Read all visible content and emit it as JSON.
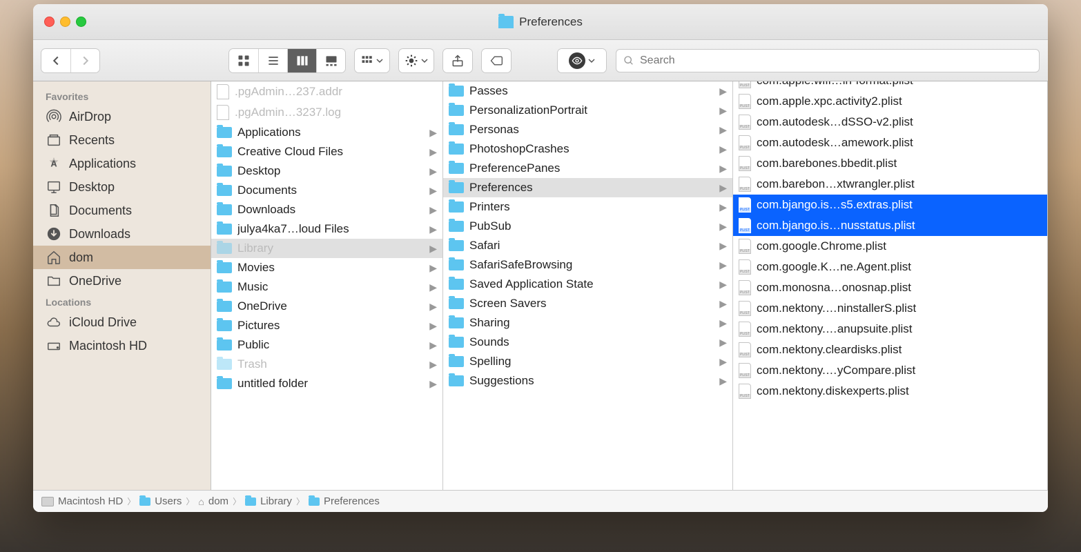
{
  "window": {
    "title": "Preferences"
  },
  "search": {
    "placeholder": "Search"
  },
  "sidebar": {
    "sections": [
      {
        "heading": "Favorites",
        "items": [
          {
            "label": "AirDrop",
            "icon": "airdrop",
            "selected": false
          },
          {
            "label": "Recents",
            "icon": "recents",
            "selected": false
          },
          {
            "label": "Applications",
            "icon": "applications",
            "selected": false
          },
          {
            "label": "Desktop",
            "icon": "desktop",
            "selected": false
          },
          {
            "label": "Documents",
            "icon": "documents",
            "selected": false
          },
          {
            "label": "Downloads",
            "icon": "downloads",
            "selected": false
          },
          {
            "label": "dom",
            "icon": "home",
            "selected": true
          },
          {
            "label": "OneDrive",
            "icon": "folder",
            "selected": false
          }
        ]
      },
      {
        "heading": "Locations",
        "items": [
          {
            "label": "iCloud Drive",
            "icon": "icloud",
            "selected": false
          },
          {
            "label": "Macintosh HD",
            "icon": "disk",
            "selected": false
          }
        ]
      }
    ]
  },
  "columns": [
    {
      "items": [
        {
          "label": ".pgAdmin…237.addr",
          "type": "file-blank",
          "dimmed": true,
          "chev": false
        },
        {
          "label": ".pgAdmin…3237.log",
          "type": "file-blank",
          "dimmed": true,
          "chev": false
        },
        {
          "label": "Applications",
          "type": "folder",
          "chev": true
        },
        {
          "label": "Creative Cloud Files",
          "type": "folder",
          "chev": true
        },
        {
          "label": "Desktop",
          "type": "folder",
          "chev": true
        },
        {
          "label": "Documents",
          "type": "folder",
          "chev": true
        },
        {
          "label": "Downloads",
          "type": "folder",
          "chev": true
        },
        {
          "label": "julya4ka7…loud Files",
          "type": "folder",
          "chev": true
        },
        {
          "label": "Library",
          "type": "folder",
          "chev": true,
          "dimmed": true,
          "selected": "grey"
        },
        {
          "label": "Movies",
          "type": "folder",
          "chev": true
        },
        {
          "label": "Music",
          "type": "folder",
          "chev": true
        },
        {
          "label": "OneDrive",
          "type": "folder",
          "chev": true
        },
        {
          "label": "Pictures",
          "type": "folder",
          "chev": true
        },
        {
          "label": "Public",
          "type": "folder",
          "chev": true
        },
        {
          "label": "Trash",
          "type": "folder",
          "chev": true,
          "dimmed": true
        },
        {
          "label": "untitled folder",
          "type": "folder",
          "chev": true
        }
      ]
    },
    {
      "items": [
        {
          "label": "Passes",
          "type": "folder",
          "chev": true
        },
        {
          "label": "PersonalizationPortrait",
          "type": "folder",
          "chev": true
        },
        {
          "label": "Personas",
          "type": "folder",
          "chev": true
        },
        {
          "label": "PhotoshopCrashes",
          "type": "folder",
          "chev": true
        },
        {
          "label": "PreferencePanes",
          "type": "folder",
          "chev": true
        },
        {
          "label": "Preferences",
          "type": "folder",
          "chev": true,
          "selected": "grey"
        },
        {
          "label": "Printers",
          "type": "folder",
          "chev": true
        },
        {
          "label": "PubSub",
          "type": "folder",
          "chev": true
        },
        {
          "label": "Safari",
          "type": "folder",
          "chev": true
        },
        {
          "label": "SafariSafeBrowsing",
          "type": "folder",
          "chev": true
        },
        {
          "label": "Saved Application State",
          "type": "folder",
          "chev": true
        },
        {
          "label": "Screen Savers",
          "type": "folder",
          "chev": true
        },
        {
          "label": "Sharing",
          "type": "folder",
          "chev": true
        },
        {
          "label": "Sounds",
          "type": "folder",
          "chev": true
        },
        {
          "label": "Spelling",
          "type": "folder",
          "chev": true
        },
        {
          "label": "Suggestions",
          "type": "folder",
          "chev": true
        }
      ]
    },
    {
      "items": [
        {
          "label": "com.apple.wifi…in-format.plist",
          "type": "plist"
        },
        {
          "label": "com.apple.xpc.activity2.plist",
          "type": "plist"
        },
        {
          "label": "com.autodesk…dSSO-v2.plist",
          "type": "plist"
        },
        {
          "label": "com.autodesk…amework.plist",
          "type": "plist"
        },
        {
          "label": "com.barebones.bbedit.plist",
          "type": "plist"
        },
        {
          "label": "com.barebon…xtwrangler.plist",
          "type": "plist"
        },
        {
          "label": "com.bjango.is…s5.extras.plist",
          "type": "plist",
          "selected": "blue"
        },
        {
          "label": "com.bjango.is…nusstatus.plist",
          "type": "plist",
          "selected": "blue"
        },
        {
          "label": "com.google.Chrome.plist",
          "type": "plist"
        },
        {
          "label": "com.google.K…ne.Agent.plist",
          "type": "plist"
        },
        {
          "label": "com.monosna…onosnap.plist",
          "type": "plist"
        },
        {
          "label": "com.nektony.…ninstallerS.plist",
          "type": "plist"
        },
        {
          "label": "com.nektony.…anupsuite.plist",
          "type": "plist"
        },
        {
          "label": "com.nektony.cleardisks.plist",
          "type": "plist"
        },
        {
          "label": "com.nektony.…yCompare.plist",
          "type": "plist"
        },
        {
          "label": "com.nektony.diskexperts.plist",
          "type": "plist"
        }
      ]
    }
  ],
  "pathbar": [
    {
      "label": "Macintosh HD",
      "icon": "disk"
    },
    {
      "label": "Users",
      "icon": "folder"
    },
    {
      "label": "dom",
      "icon": "home"
    },
    {
      "label": "Library",
      "icon": "folder"
    },
    {
      "label": "Preferences",
      "icon": "folder"
    }
  ]
}
